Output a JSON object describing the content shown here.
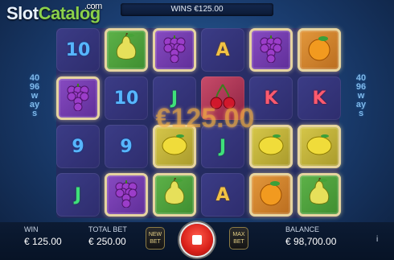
{
  "logo": {
    "text_main": "Slot",
    "text_accent": "Catalog",
    "suffix": ".com"
  },
  "topbar": {
    "wins_label": "WINS",
    "wins_value": "€125.00"
  },
  "side": {
    "ways_text": "4096 ways"
  },
  "reels": {
    "rows": [
      [
        {
          "sym": "10",
          "bg": "",
          "color": "t-blue",
          "framed": false
        },
        {
          "sym": "pear",
          "bg": "g",
          "framed": true
        },
        {
          "sym": "grapes",
          "bg": "p",
          "framed": true
        },
        {
          "sym": "A",
          "bg": "",
          "color": "t-gold",
          "framed": false
        },
        {
          "sym": "grapes",
          "bg": "p",
          "framed": true
        },
        {
          "sym": "orange",
          "bg": "o",
          "framed": true
        }
      ],
      [
        {
          "sym": "grapes",
          "bg": "p",
          "framed": true
        },
        {
          "sym": "10",
          "bg": "",
          "color": "t-blue",
          "framed": false
        },
        {
          "sym": "J",
          "bg": "",
          "color": "t-green",
          "framed": false
        },
        {
          "sym": "cherries",
          "bg": "r",
          "framed": false
        },
        {
          "sym": "K",
          "bg": "",
          "color": "t-pink",
          "framed": false
        },
        {
          "sym": "K",
          "bg": "",
          "color": "t-pink",
          "framed": false
        }
      ],
      [
        {
          "sym": "9",
          "bg": "",
          "color": "t-blue",
          "framed": false
        },
        {
          "sym": "9",
          "bg": "",
          "color": "t-blue",
          "framed": false
        },
        {
          "sym": "lemon",
          "bg": "y",
          "framed": true
        },
        {
          "sym": "J",
          "bg": "",
          "color": "t-green",
          "framed": false
        },
        {
          "sym": "lemon",
          "bg": "y",
          "framed": true
        },
        {
          "sym": "lemon",
          "bg": "y",
          "framed": true
        }
      ],
      [
        {
          "sym": "J",
          "bg": "",
          "color": "t-green",
          "framed": false
        },
        {
          "sym": "grapes",
          "bg": "p",
          "framed": true
        },
        {
          "sym": "pear",
          "bg": "g",
          "framed": true
        },
        {
          "sym": "A",
          "bg": "",
          "color": "t-gold",
          "framed": false
        },
        {
          "sym": "orange",
          "bg": "o",
          "framed": true
        },
        {
          "sym": "pear",
          "bg": "g",
          "framed": true
        }
      ]
    ]
  },
  "win_overlay": "€125.00",
  "footer": {
    "win_label": "WIN",
    "win_value": "€ 125.00",
    "total_bet_label": "TOTAL BET",
    "total_bet_value": "€ 250.00",
    "new_bet_label": "NEW BET",
    "max_bet_label": "MAX BET",
    "balance_label": "BALANCE",
    "balance_value": "€ 98,700.00",
    "info_label": "i"
  }
}
